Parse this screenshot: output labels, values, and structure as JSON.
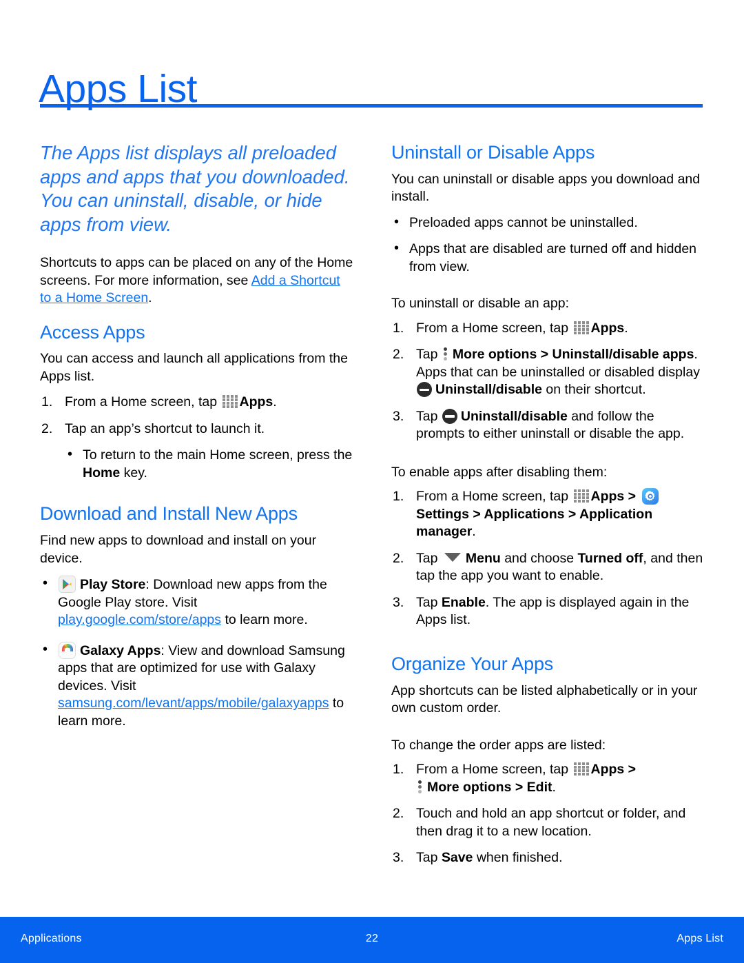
{
  "page": {
    "title": "Apps List",
    "accent_color": "#0a63ec",
    "footer_bar_color": "#0663ed",
    "link_color": "#1273ef",
    "body_color": "#000000"
  },
  "left_column": {
    "lede": "The Apps list displays all preloaded apps and apps that you downloaded. You can uninstall, disable, or hide apps from view.",
    "intro": {
      "text_before_link": "Shortcuts to apps can be placed on any of the Home screens. For more information, see ",
      "link_text": "Add a Shortcut to a Home Screen",
      "text_after_link": "."
    },
    "access_apps": {
      "heading": "Access Apps",
      "body": "You can access and launch all applications from the Apps list.",
      "step1_a": "From a Home screen, tap",
      "step1_apps_label": "Apps",
      "step1_b": ".",
      "step2": "Tap an app’s shortcut to launch it.",
      "step2_sub_a": "To return to the main Home screen, press the ",
      "step2_sub_home": "Home",
      "step2_sub_b": " key."
    },
    "download_install": {
      "heading": "Download and Install New Apps",
      "body": "Find new apps to download and install on your device.",
      "play_store": {
        "icon": "play-store-icon",
        "name": "Play Store",
        "text_before_link": ": Download new apps from the Google Play store. Visit ",
        "link_text": "play.google.com/store/apps",
        "text_after_link": " to learn more."
      },
      "galaxy_apps": {
        "icon": "galaxy-apps-icon",
        "name": "Galaxy Apps",
        "text_before_link": ": View and download Samsung apps that are optimized for use with Galaxy devices. Visit ",
        "link_text": "samsung.com/levant/apps/mobile/galaxyapps",
        "text_after_link": " to learn more."
      }
    }
  },
  "right_column": {
    "uninstall_disable": {
      "heading": "Uninstall or Disable Apps",
      "body": "You can uninstall or disable apps you download and install.",
      "bullets": [
        "Preloaded apps cannot be uninstalled.",
        "Apps that are disabled are turned off and hidden from view."
      ],
      "lead_in": "To uninstall or disable an app:",
      "step1_a": "From a Home screen, tap",
      "step1_apps_label": "Apps",
      "step1_b": ".",
      "step2_a": "Tap",
      "step2_more_options": "More options",
      "step2_gt": " > ",
      "step2_uninstall_apps": "Uninstall/disable apps",
      "step2_b": ". Apps that can be uninstalled or disabled display",
      "step2_uninstall_label": "Uninstall/disable",
      "step2_c": " on their shortcut.",
      "step3_a": "Tap",
      "step3_uninstall_label": "Uninstall/disable",
      "step3_b": " and follow the prompts to either uninstall or disable the app."
    },
    "enable_apps": {
      "lead_in": "To enable apps after disabling them:",
      "step1_a": "From a Home screen, tap",
      "step1_apps_label": "Apps",
      "step1_gt1": " > ",
      "step1_settings_label": "Settings",
      "step1_path": " > Applications > Application manager",
      "step1_end": ".",
      "step2_a": "Tap",
      "step2_menu_label": "Menu",
      "step2_b": " and choose ",
      "step2_turned_off": "Turned off",
      "step2_c": ", and then tap the app you want to enable.",
      "step3_a": "Tap ",
      "step3_enable": "Enable",
      "step3_b": ". The app is displayed again in the Apps list."
    },
    "organize": {
      "heading": "Organize Your Apps",
      "body": "App shortcuts can be listed alphabetically or in your own custom order.",
      "lead_in": "To change the order apps are listed:",
      "step1_a": "From a Home screen, tap",
      "step1_apps_label": "Apps",
      "step1_gt": " >",
      "step1_more_options": "More options",
      "step1_gt2": " > ",
      "step1_edit": "Edit",
      "step1_end": ".",
      "step2": "Touch and hold an app shortcut or folder, and then drag it to a new location.",
      "step3_a": "Tap ",
      "step3_save": "Save",
      "step3_b": " when finished."
    }
  },
  "footer": {
    "left": "Applications",
    "page_number": "22",
    "right": "Apps List"
  }
}
